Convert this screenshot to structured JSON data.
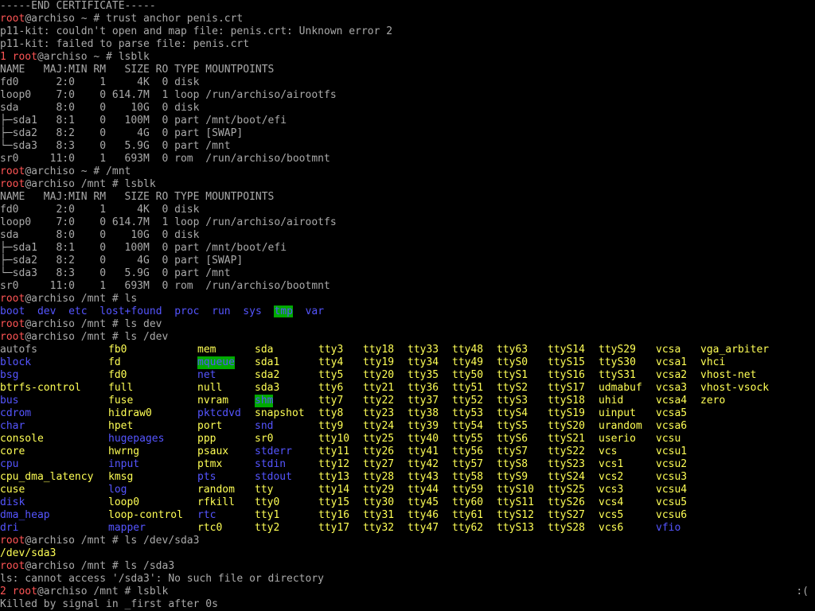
{
  "terminal": {
    "lines": [
      [
        {
          "t": "-----END CERTIFICATE-----",
          "c": "gray"
        }
      ],
      [
        {
          "t": "root",
          "c": "red"
        },
        {
          "t": "@archiso ~ # trust anchor penis.crt",
          "c": "gray"
        }
      ],
      [
        {
          "t": "p11-kit: couldn't open and map file: penis.crt: Unknown error 2",
          "c": "gray"
        }
      ],
      [
        {
          "t": "p11-kit: failed to parse file: penis.crt",
          "c": "gray"
        }
      ],
      [
        {
          "t": "1 root",
          "c": "red"
        },
        {
          "t": "@archiso ~ # lsblk",
          "c": "gray"
        }
      ],
      [
        {
          "t": "NAME   MAJ:MIN RM   SIZE RO TYPE MOUNTPOINTS",
          "c": "gray"
        }
      ],
      [
        {
          "t": "fd0      2:0    1     4K  0 disk",
          "c": "gray"
        }
      ],
      [
        {
          "t": "loop0    7:0    0 614.7M  1 loop /run/archiso/airootfs",
          "c": "gray"
        }
      ],
      [
        {
          "t": "sda      8:0    0    10G  0 disk",
          "c": "gray"
        }
      ],
      [
        {
          "t": "├─sda1   8:1    0   100M  0 part /mnt/boot/efi",
          "c": "gray"
        }
      ],
      [
        {
          "t": "├─sda2   8:2    0     4G  0 part [SWAP]",
          "c": "gray"
        }
      ],
      [
        {
          "t": "└─sda3   8:3    0   5.9G  0 part /mnt",
          "c": "gray"
        }
      ],
      [
        {
          "t": "sr0     11:0    1   693M  0 rom  /run/archiso/bootmnt",
          "c": "gray"
        }
      ],
      [
        {
          "t": "root",
          "c": "red"
        },
        {
          "t": "@archiso ~ # /mnt",
          "c": "gray"
        }
      ],
      [
        {
          "t": "root",
          "c": "red"
        },
        {
          "t": "@archiso /mnt # lsblk",
          "c": "gray"
        }
      ],
      [
        {
          "t": "NAME   MAJ:MIN RM   SIZE RO TYPE MOUNTPOINTS",
          "c": "gray"
        }
      ],
      [
        {
          "t": "fd0      2:0    1     4K  0 disk",
          "c": "gray"
        }
      ],
      [
        {
          "t": "loop0    7:0    0 614.7M  1 loop /run/archiso/airootfs",
          "c": "gray"
        }
      ],
      [
        {
          "t": "sda      8:0    0    10G  0 disk",
          "c": "gray"
        }
      ],
      [
        {
          "t": "├─sda1   8:1    0   100M  0 part /mnt/boot/efi",
          "c": "gray"
        }
      ],
      [
        {
          "t": "├─sda2   8:2    0     4G  0 part [SWAP]",
          "c": "gray"
        }
      ],
      [
        {
          "t": "└─sda3   8:3    0   5.9G  0 part /mnt",
          "c": "gray"
        }
      ],
      [
        {
          "t": "sr0     11:0    1   693M  0 rom  /run/archiso/bootmnt",
          "c": "gray"
        }
      ],
      [
        {
          "t": "root",
          "c": "red"
        },
        {
          "t": "@archiso /mnt # ls",
          "c": "gray"
        }
      ],
      [
        {
          "t": "boot",
          "c": "blue"
        },
        {
          "t": "  ",
          "c": "gray"
        },
        {
          "t": "dev",
          "c": "blue"
        },
        {
          "t": "  ",
          "c": "gray"
        },
        {
          "t": "etc",
          "c": "blue"
        },
        {
          "t": "  ",
          "c": "gray"
        },
        {
          "t": "lost+found",
          "c": "blue"
        },
        {
          "t": "  ",
          "c": "gray"
        },
        {
          "t": "proc",
          "c": "blue"
        },
        {
          "t": "  ",
          "c": "gray"
        },
        {
          "t": "run",
          "c": "blue"
        },
        {
          "t": "  ",
          "c": "gray"
        },
        {
          "t": "sys",
          "c": "blue"
        },
        {
          "t": "  ",
          "c": "gray"
        },
        {
          "t": "tmp",
          "c": "hl"
        },
        {
          "t": "  ",
          "c": "gray"
        },
        {
          "t": "var",
          "c": "blue"
        }
      ],
      [
        {
          "t": "root",
          "c": "red"
        },
        {
          "t": "@archiso /mnt # ls dev",
          "c": "gray"
        }
      ],
      [
        {
          "t": "root",
          "c": "red"
        },
        {
          "t": "@archiso /mnt # ls /dev",
          "c": "gray"
        }
      ]
    ],
    "dev_listing": [
      [
        {
          "t": "autofs",
          "c": "gray"
        },
        {
          "t": "fb0",
          "c": "yellow"
        },
        {
          "t": "mem",
          "c": "yellow"
        },
        {
          "t": "sda",
          "c": "yellow"
        },
        {
          "t": "tty3",
          "c": "yellow"
        },
        {
          "t": "tty18",
          "c": "yellow"
        },
        {
          "t": "tty33",
          "c": "yellow"
        },
        {
          "t": "tty48",
          "c": "yellow"
        },
        {
          "t": "tty63",
          "c": "yellow"
        },
        {
          "t": "ttyS14",
          "c": "yellow"
        },
        {
          "t": "ttyS29",
          "c": "yellow"
        },
        {
          "t": "vcsa",
          "c": "yellow"
        },
        {
          "t": "vga_arbiter",
          "c": "yellow"
        }
      ],
      [
        {
          "t": "block",
          "c": "blue"
        },
        {
          "t": "fd",
          "c": "yellow"
        },
        {
          "t": "mqueue",
          "c": "hl"
        },
        {
          "t": "sda1",
          "c": "yellow"
        },
        {
          "t": "tty4",
          "c": "yellow"
        },
        {
          "t": "tty19",
          "c": "yellow"
        },
        {
          "t": "tty34",
          "c": "yellow"
        },
        {
          "t": "tty49",
          "c": "yellow"
        },
        {
          "t": "ttyS0",
          "c": "yellow"
        },
        {
          "t": "ttyS15",
          "c": "yellow"
        },
        {
          "t": "ttyS30",
          "c": "yellow"
        },
        {
          "t": "vcsa1",
          "c": "yellow"
        },
        {
          "t": "vhci",
          "c": "yellow"
        }
      ],
      [
        {
          "t": "bsg",
          "c": "blue"
        },
        {
          "t": "fd0",
          "c": "yellow"
        },
        {
          "t": "net",
          "c": "blue"
        },
        {
          "t": "sda2",
          "c": "yellow"
        },
        {
          "t": "tty5",
          "c": "yellow"
        },
        {
          "t": "tty20",
          "c": "yellow"
        },
        {
          "t": "tty35",
          "c": "yellow"
        },
        {
          "t": "tty50",
          "c": "yellow"
        },
        {
          "t": "ttyS1",
          "c": "yellow"
        },
        {
          "t": "ttyS16",
          "c": "yellow"
        },
        {
          "t": "ttyS31",
          "c": "yellow"
        },
        {
          "t": "vcsa2",
          "c": "yellow"
        },
        {
          "t": "vhost-net",
          "c": "yellow"
        }
      ],
      [
        {
          "t": "btrfs-control",
          "c": "yellow"
        },
        {
          "t": "full",
          "c": "yellow"
        },
        {
          "t": "null",
          "c": "yellow"
        },
        {
          "t": "sda3",
          "c": "yellow"
        },
        {
          "t": "tty6",
          "c": "yellow"
        },
        {
          "t": "tty21",
          "c": "yellow"
        },
        {
          "t": "tty36",
          "c": "yellow"
        },
        {
          "t": "tty51",
          "c": "yellow"
        },
        {
          "t": "ttyS2",
          "c": "yellow"
        },
        {
          "t": "ttyS17",
          "c": "yellow"
        },
        {
          "t": "udmabuf",
          "c": "yellow"
        },
        {
          "t": "vcsa3",
          "c": "yellow"
        },
        {
          "t": "vhost-vsock",
          "c": "yellow"
        }
      ],
      [
        {
          "t": "bus",
          "c": "blue"
        },
        {
          "t": "fuse",
          "c": "yellow"
        },
        {
          "t": "nvram",
          "c": "yellow"
        },
        {
          "t": "shm",
          "c": "hl"
        },
        {
          "t": "tty7",
          "c": "yellow"
        },
        {
          "t": "tty22",
          "c": "yellow"
        },
        {
          "t": "tty37",
          "c": "yellow"
        },
        {
          "t": "tty52",
          "c": "yellow"
        },
        {
          "t": "ttyS3",
          "c": "yellow"
        },
        {
          "t": "ttyS18",
          "c": "yellow"
        },
        {
          "t": "uhid",
          "c": "yellow"
        },
        {
          "t": "vcsa4",
          "c": "yellow"
        },
        {
          "t": "zero",
          "c": "yellow"
        }
      ],
      [
        {
          "t": "cdrom",
          "c": "blue"
        },
        {
          "t": "hidraw0",
          "c": "yellow"
        },
        {
          "t": "pktcdvd",
          "c": "blue"
        },
        {
          "t": "snapshot",
          "c": "yellow"
        },
        {
          "t": "tty8",
          "c": "yellow"
        },
        {
          "t": "tty23",
          "c": "yellow"
        },
        {
          "t": "tty38",
          "c": "yellow"
        },
        {
          "t": "tty53",
          "c": "yellow"
        },
        {
          "t": "ttyS4",
          "c": "yellow"
        },
        {
          "t": "ttyS19",
          "c": "yellow"
        },
        {
          "t": "uinput",
          "c": "yellow"
        },
        {
          "t": "vcsa5",
          "c": "yellow"
        }
      ],
      [
        {
          "t": "char",
          "c": "blue"
        },
        {
          "t": "hpet",
          "c": "yellow"
        },
        {
          "t": "port",
          "c": "yellow"
        },
        {
          "t": "snd",
          "c": "blue"
        },
        {
          "t": "tty9",
          "c": "yellow"
        },
        {
          "t": "tty24",
          "c": "yellow"
        },
        {
          "t": "tty39",
          "c": "yellow"
        },
        {
          "t": "tty54",
          "c": "yellow"
        },
        {
          "t": "ttyS5",
          "c": "yellow"
        },
        {
          "t": "ttyS20",
          "c": "yellow"
        },
        {
          "t": "urandom",
          "c": "yellow"
        },
        {
          "t": "vcsa6",
          "c": "yellow"
        }
      ],
      [
        {
          "t": "console",
          "c": "yellow"
        },
        {
          "t": "hugepages",
          "c": "blue"
        },
        {
          "t": "ppp",
          "c": "yellow"
        },
        {
          "t": "sr0",
          "c": "yellow"
        },
        {
          "t": "tty10",
          "c": "yellow"
        },
        {
          "t": "tty25",
          "c": "yellow"
        },
        {
          "t": "tty40",
          "c": "yellow"
        },
        {
          "t": "tty55",
          "c": "yellow"
        },
        {
          "t": "ttyS6",
          "c": "yellow"
        },
        {
          "t": "ttyS21",
          "c": "yellow"
        },
        {
          "t": "userio",
          "c": "yellow"
        },
        {
          "t": "vcsu",
          "c": "yellow"
        }
      ],
      [
        {
          "t": "core",
          "c": "yellow"
        },
        {
          "t": "hwrng",
          "c": "yellow"
        },
        {
          "t": "psaux",
          "c": "yellow"
        },
        {
          "t": "stderr",
          "c": "blue"
        },
        {
          "t": "tty11",
          "c": "yellow"
        },
        {
          "t": "tty26",
          "c": "yellow"
        },
        {
          "t": "tty41",
          "c": "yellow"
        },
        {
          "t": "tty56",
          "c": "yellow"
        },
        {
          "t": "ttyS7",
          "c": "yellow"
        },
        {
          "t": "ttyS22",
          "c": "yellow"
        },
        {
          "t": "vcs",
          "c": "yellow"
        },
        {
          "t": "vcsu1",
          "c": "yellow"
        }
      ],
      [
        {
          "t": "cpu",
          "c": "blue"
        },
        {
          "t": "input",
          "c": "blue"
        },
        {
          "t": "ptmx",
          "c": "yellow"
        },
        {
          "t": "stdin",
          "c": "blue"
        },
        {
          "t": "tty12",
          "c": "yellow"
        },
        {
          "t": "tty27",
          "c": "yellow"
        },
        {
          "t": "tty42",
          "c": "yellow"
        },
        {
          "t": "tty57",
          "c": "yellow"
        },
        {
          "t": "ttyS8",
          "c": "yellow"
        },
        {
          "t": "ttyS23",
          "c": "yellow"
        },
        {
          "t": "vcs1",
          "c": "yellow"
        },
        {
          "t": "vcsu2",
          "c": "yellow"
        }
      ],
      [
        {
          "t": "cpu_dma_latency",
          "c": "yellow"
        },
        {
          "t": "kmsg",
          "c": "yellow"
        },
        {
          "t": "pts",
          "c": "blue"
        },
        {
          "t": "stdout",
          "c": "blue"
        },
        {
          "t": "tty13",
          "c": "yellow"
        },
        {
          "t": "tty28",
          "c": "yellow"
        },
        {
          "t": "tty43",
          "c": "yellow"
        },
        {
          "t": "tty58",
          "c": "yellow"
        },
        {
          "t": "ttyS9",
          "c": "yellow"
        },
        {
          "t": "ttyS24",
          "c": "yellow"
        },
        {
          "t": "vcs2",
          "c": "yellow"
        },
        {
          "t": "vcsu3",
          "c": "yellow"
        }
      ],
      [
        {
          "t": "cuse",
          "c": "yellow"
        },
        {
          "t": "log",
          "c": "blue"
        },
        {
          "t": "random",
          "c": "yellow"
        },
        {
          "t": "tty",
          "c": "yellow"
        },
        {
          "t": "tty14",
          "c": "yellow"
        },
        {
          "t": "tty29",
          "c": "yellow"
        },
        {
          "t": "tty44",
          "c": "yellow"
        },
        {
          "t": "tty59",
          "c": "yellow"
        },
        {
          "t": "ttyS10",
          "c": "yellow"
        },
        {
          "t": "ttyS25",
          "c": "yellow"
        },
        {
          "t": "vcs3",
          "c": "yellow"
        },
        {
          "t": "vcsu4",
          "c": "yellow"
        }
      ],
      [
        {
          "t": "disk",
          "c": "blue"
        },
        {
          "t": "loop0",
          "c": "yellow"
        },
        {
          "t": "rfkill",
          "c": "yellow"
        },
        {
          "t": "tty0",
          "c": "yellow"
        },
        {
          "t": "tty15",
          "c": "yellow"
        },
        {
          "t": "tty30",
          "c": "yellow"
        },
        {
          "t": "tty45",
          "c": "yellow"
        },
        {
          "t": "tty60",
          "c": "yellow"
        },
        {
          "t": "ttyS11",
          "c": "yellow"
        },
        {
          "t": "ttyS26",
          "c": "yellow"
        },
        {
          "t": "vcs4",
          "c": "yellow"
        },
        {
          "t": "vcsu5",
          "c": "yellow"
        }
      ],
      [
        {
          "t": "dma_heap",
          "c": "blue"
        },
        {
          "t": "loop-control",
          "c": "yellow"
        },
        {
          "t": "rtc",
          "c": "blue"
        },
        {
          "t": "tty1",
          "c": "yellow"
        },
        {
          "t": "tty16",
          "c": "yellow"
        },
        {
          "t": "tty31",
          "c": "yellow"
        },
        {
          "t": "tty46",
          "c": "yellow"
        },
        {
          "t": "tty61",
          "c": "yellow"
        },
        {
          "t": "ttyS12",
          "c": "yellow"
        },
        {
          "t": "ttyS27",
          "c": "yellow"
        },
        {
          "t": "vcs5",
          "c": "yellow"
        },
        {
          "t": "vcsu6",
          "c": "yellow"
        }
      ],
      [
        {
          "t": "dri",
          "c": "blue"
        },
        {
          "t": "mapper",
          "c": "blue"
        },
        {
          "t": "rtc0",
          "c": "yellow"
        },
        {
          "t": "tty2",
          "c": "yellow"
        },
        {
          "t": "tty17",
          "c": "yellow"
        },
        {
          "t": "tty32",
          "c": "yellow"
        },
        {
          "t": "tty47",
          "c": "yellow"
        },
        {
          "t": "tty62",
          "c": "yellow"
        },
        {
          "t": "ttyS13",
          "c": "yellow"
        },
        {
          "t": "ttyS28",
          "c": "yellow"
        },
        {
          "t": "vcs6",
          "c": "yellow"
        },
        {
          "t": "vfio",
          "c": "blue"
        }
      ]
    ],
    "after_lines": [
      [
        {
          "t": "root",
          "c": "red"
        },
        {
          "t": "@archiso /mnt # ls /dev/sda3",
          "c": "gray"
        }
      ],
      [
        {
          "t": "/dev/sda3",
          "c": "yellow"
        }
      ],
      [
        {
          "t": "root",
          "c": "red"
        },
        {
          "t": "@archiso /mnt # ls /sda3",
          "c": "gray"
        }
      ],
      [
        {
          "t": "ls: cannot access '/sda3': No such file or directory",
          "c": "gray"
        }
      ],
      [
        {
          "t": "2 root",
          "c": "red"
        },
        {
          "t": "@archiso /mnt # lsblk",
          "c": "gray"
        }
      ],
      [
        {
          "t": "Killed by signal in _first after 0s",
          "c": "gray"
        }
      ]
    ],
    "status_indicator": ":(",
    "colors": {
      "background": "#000000",
      "gray": "#aaaaaa",
      "red": "#ff5555",
      "blue": "#5555ff",
      "yellow": "#ffff55",
      "highlight_bg": "#00aa00"
    }
  }
}
